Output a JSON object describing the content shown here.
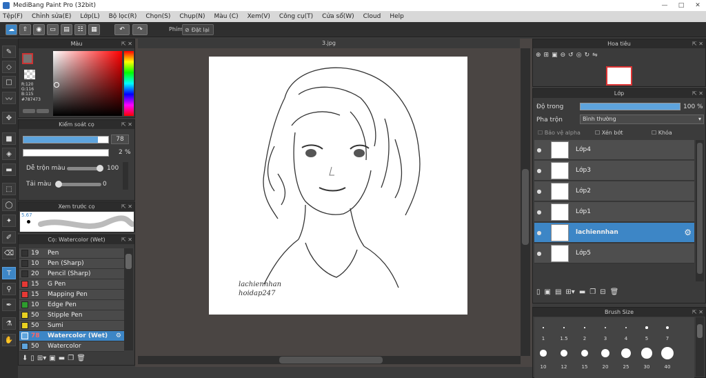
{
  "window": {
    "title": "MediBang Paint Pro (32bit)",
    "controls": [
      "—",
      "□",
      "✕"
    ]
  },
  "menu": [
    "Tệp(F)",
    "Chỉnh sửa(E)",
    "Lớp(L)",
    "Bộ lọc(R)",
    "Chọn(S)",
    "Chụp(N)",
    "Màu (C)",
    "Xem(V)",
    "Công cụ(T)",
    "Cửa sổ(W)",
    "Cloud",
    "Help"
  ],
  "toolbar": {
    "label": "Phím",
    "reset": "Đặt lại"
  },
  "color": {
    "title": "Màu",
    "rgb": "R:120\nG:116\nB:115",
    "hex": "#787473",
    "fg": "#787473"
  },
  "brush_control": {
    "title": "Kiểm soát cọ",
    "size": "78",
    "opacity": "2",
    "pct": "%",
    "mix_label": "Dễ trộn màu",
    "mix_value": "100",
    "color_amount_label": "Tải màu",
    "color_amount_value": "0"
  },
  "preview": {
    "title": "Xem trước cọ",
    "size": "5.67"
  },
  "brush_list": {
    "title": "Cọ: Watercolor (Wet)",
    "items": [
      {
        "size": "19",
        "name": "Pen",
        "color": "#333333"
      },
      {
        "size": "10",
        "name": "Pen (Sharp)",
        "color": "#333333"
      },
      {
        "size": "20",
        "name": "Pencil (Sharp)",
        "color": "#333333"
      },
      {
        "size": "15",
        "name": "G Pen",
        "color": "#e53935"
      },
      {
        "size": "15",
        "name": "Mapping Pen",
        "color": "#e53935"
      },
      {
        "size": "10",
        "name": "Edge Pen",
        "color": "#2e9d2e"
      },
      {
        "size": "50",
        "name": "Stipple Pen",
        "color": "#e8d021"
      },
      {
        "size": "50",
        "name": "Sumi",
        "color": "#e8d021"
      },
      {
        "size": "78",
        "name": "Watercolor (Wet)",
        "color": "#3d86c6"
      },
      {
        "size": "50",
        "name": "Watercolor",
        "color": "#3d86c6"
      }
    ]
  },
  "canvas": {
    "tab": "3.jpg",
    "signature_line1": "lachiennhan",
    "signature_line2": "hoidap247"
  },
  "navigator": {
    "title": "Hoa tiêu"
  },
  "layers": {
    "title": "Lớp",
    "opacity_label": "Độ trong",
    "opacity_value": "100 %",
    "opacity_fraction": 1.0,
    "blend_label": "Pha trộn",
    "blend_value": "Bình thường",
    "protect_alpha": "Bảo vệ alpha",
    "clipping": "Xén bớt",
    "lock": "Khóa",
    "items": [
      {
        "name": "Lớp4"
      },
      {
        "name": "Lớp3"
      },
      {
        "name": "Lớp2"
      },
      {
        "name": "Lớp1"
      },
      {
        "name": "lachiennhan"
      },
      {
        "name": "Lớp5"
      }
    ]
  },
  "brush_size": {
    "title": "Brush Size",
    "row1": [
      "1",
      "1.5",
      "2",
      "3",
      "4",
      "5",
      "7"
    ],
    "row2": [
      "10",
      "12",
      "15",
      "20",
      "25",
      "30",
      "40"
    ]
  }
}
